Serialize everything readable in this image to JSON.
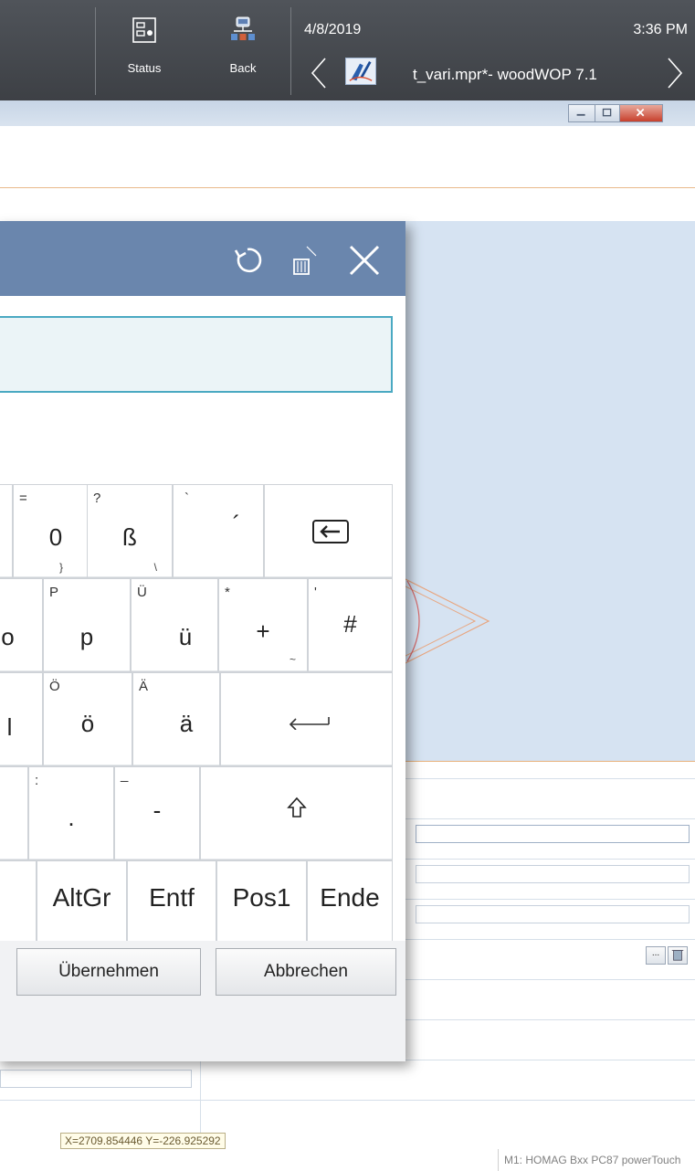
{
  "topbar": {
    "status_label": "Status",
    "back_label": "Back",
    "date": "4/8/2019",
    "time": "3:36 PM",
    "app_title": "t_vari.mpr*- woodWOP 7.1",
    "icons": [
      "status-icon",
      "back-icon",
      "chevron-left-icon",
      "woodwop-app-icon",
      "chevron-right-icon"
    ]
  },
  "window": {
    "controls": [
      "minimize-icon",
      "maximize-icon",
      "close-icon"
    ]
  },
  "keyboard_dialog": {
    "header_icons": [
      "reset-icon",
      "clear-icon",
      "close-icon"
    ],
    "input_value": "",
    "rows": [
      [
        {
          "id": "0",
          "main": "0",
          "shift": "=",
          "alt": "}"
        },
        {
          "id": "sz",
          "main": "ß",
          "shift": "?",
          "alt": "\\"
        },
        {
          "id": "acute",
          "main": "´",
          "shift": "`",
          "alt": ""
        },
        {
          "id": "backspace",
          "main": "",
          "shift": "",
          "alt": ""
        }
      ],
      [
        {
          "id": "o",
          "main": "o",
          "shift": "",
          "alt": ""
        },
        {
          "id": "p",
          "main": "p",
          "shift": "P",
          "alt": ""
        },
        {
          "id": "ue",
          "main": "ü",
          "shift": "Ü",
          "alt": ""
        },
        {
          "id": "plus",
          "main": "+",
          "shift": "*",
          "alt": "~"
        },
        {
          "id": "hash",
          "main": "#",
          "shift": "'",
          "alt": ""
        }
      ],
      [
        {
          "id": "l",
          "main": "l",
          "shift": "",
          "alt": ""
        },
        {
          "id": "oe",
          "main": "ö",
          "shift": "Ö",
          "alt": ""
        },
        {
          "id": "ae",
          "main": "ä",
          "shift": "Ä",
          "alt": ""
        },
        {
          "id": "enter",
          "main": "",
          "shift": "",
          "alt": ""
        }
      ],
      [
        {
          "id": "blank",
          "main": "",
          "shift": "",
          "alt": ""
        },
        {
          "id": "period",
          "main": ".",
          "shift": ":",
          "alt": ""
        },
        {
          "id": "minus",
          "main": "-",
          "shift": "_",
          "alt": ""
        },
        {
          "id": "shift",
          "main": "",
          "shift": "",
          "alt": ""
        }
      ],
      [
        {
          "id": "blank2",
          "main": "",
          "shift": "",
          "alt": ""
        },
        {
          "id": "altgr",
          "main": "AltGr",
          "shift": "",
          "alt": ""
        },
        {
          "id": "entf",
          "main": "Entf",
          "shift": "",
          "alt": ""
        },
        {
          "id": "pos1",
          "main": "Pos1",
          "shift": "",
          "alt": ""
        },
        {
          "id": "ende",
          "main": "Ende",
          "shift": "",
          "alt": ""
        }
      ]
    ],
    "special_key_icons": {
      "backspace": "backspace-icon",
      "enter": "enter-icon",
      "shift": "shift-icon"
    },
    "apply_label": "Übernehmen",
    "cancel_label": "Abbrechen"
  },
  "properties_panel": {
    "button_icons": [
      "more-options-icon",
      "delete-icon"
    ],
    "more_label": "..."
  },
  "status": {
    "coordinates": "X=2709.854446 Y=-226.925292",
    "machine": "M1: HOMAG Bxx PC87 powerTouch"
  },
  "colors": {
    "topbar": "#45484d",
    "dialog_header": "#6a86ad",
    "canvas": "#d6e3f2",
    "input_border": "#4aa9c2"
  }
}
